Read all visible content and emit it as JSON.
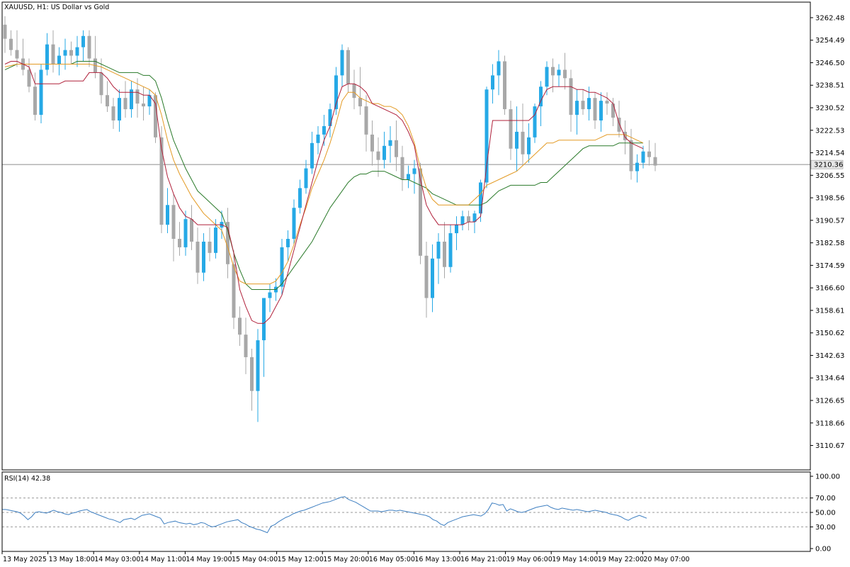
{
  "chart_data": [
    {
      "type": "candlestick",
      "title": "XAUUSD, H1:  US Dollar vs Gold",
      "price_axis": {
        "ylim": [
          3102.0,
          3268.0
        ],
        "ticks": [
          "3262.48",
          "3254.49",
          "3246.50",
          "3238.51",
          "3230.52",
          "3222.53",
          "3214.54",
          "3206.55",
          "3198.56",
          "3190.57",
          "3182.58",
          "3174.59",
          "3166.60",
          "3158.61",
          "3150.62",
          "3142.63",
          "3134.64",
          "3126.65",
          "3118.66",
          "3110.67"
        ]
      },
      "current_price": {
        "value": 3210.36,
        "label": "3210.36"
      },
      "x_labels": [
        "13 May 2025",
        "13 May 18:00",
        "14 May 03:00",
        "14 May 11:00",
        "14 May 19:00",
        "15 May 04:00",
        "15 May 12:00",
        "15 May 20:00",
        "16 May 05:00",
        "16 May 13:00",
        "16 May 21:00",
        "19 May 06:00",
        "19 May 14:00",
        "19 May 22:00",
        "20 May 07:00"
      ],
      "colors": {
        "bull": "#26A9E6",
        "bear": "#A8A8A8",
        "ma_fast": "#B0203A",
        "ma_mid": "#E39A24",
        "ma_slow": "#2A7A2A",
        "price_line": "#8C8C8C"
      },
      "ohlc": [
        [
          3260,
          3263,
          3250,
          3255
        ],
        [
          3255,
          3258,
          3249,
          3251
        ],
        [
          3251,
          3258,
          3245,
          3248
        ],
        [
          3248,
          3255,
          3242,
          3244
        ],
        [
          3244,
          3248,
          3236,
          3238
        ],
        [
          3238,
          3243,
          3226,
          3228
        ],
        [
          3228,
          3246,
          3225,
          3244
        ],
        [
          3244,
          3257,
          3242,
          3253
        ],
        [
          3253,
          3258,
          3243,
          3246
        ],
        [
          3246,
          3252,
          3242,
          3249
        ],
        [
          3249,
          3255,
          3244,
          3251
        ],
        [
          3251,
          3254,
          3246,
          3249
        ],
        [
          3249,
          3256,
          3245,
          3252
        ],
        [
          3252,
          3258,
          3247,
          3256
        ],
        [
          3256,
          3258,
          3245,
          3248
        ],
        [
          3248,
          3256,
          3241,
          3243
        ],
        [
          3243,
          3248,
          3232,
          3235
        ],
        [
          3235,
          3240,
          3229,
          3231
        ],
        [
          3231,
          3234,
          3223,
          3226
        ],
        [
          3226,
          3237,
          3222,
          3234
        ],
        [
          3234,
          3240,
          3227,
          3230
        ],
        [
          3230,
          3240,
          3227,
          3237
        ],
        [
          3237,
          3241,
          3227,
          3232
        ],
        [
          3232,
          3238,
          3226,
          3231
        ],
        [
          3231,
          3237,
          3228,
          3235
        ],
        [
          3235,
          3236,
          3218,
          3220
        ],
        [
          3220,
          3224,
          3186,
          3189
        ],
        [
          3189,
          3202,
          3186,
          3196
        ],
        [
          3196,
          3200,
          3176,
          3184
        ],
        [
          3184,
          3190,
          3178,
          3181
        ],
        [
          3181,
          3194,
          3178,
          3191
        ],
        [
          3191,
          3196,
          3180,
          3183
        ],
        [
          3183,
          3188,
          3168,
          3172
        ],
        [
          3172,
          3186,
          3169,
          3183
        ],
        [
          3183,
          3188,
          3176,
          3179
        ],
        [
          3179,
          3191,
          3177,
          3188
        ],
        [
          3188,
          3194,
          3184,
          3190
        ],
        [
          3190,
          3195,
          3170,
          3175
        ],
        [
          3175,
          3180,
          3152,
          3156
        ],
        [
          3156,
          3160,
          3146,
          3150
        ],
        [
          3150,
          3156,
          3136,
          3142
        ],
        [
          3142,
          3145,
          3123,
          3130
        ],
        [
          3130,
          3152,
          3119,
          3148
        ],
        [
          3148,
          3161,
          3135,
          3163
        ],
        [
          3163,
          3168,
          3158,
          3165
        ],
        [
          3165,
          3170,
          3162,
          3167
        ],
        [
          3167,
          3184,
          3164,
          3181
        ],
        [
          3181,
          3187,
          3176,
          3184
        ],
        [
          3184,
          3198,
          3182,
          3195
        ],
        [
          3195,
          3205,
          3193,
          3202
        ],
        [
          3202,
          3212,
          3200,
          3209
        ],
        [
          3209,
          3222,
          3207,
          3218
        ],
        [
          3218,
          3224,
          3214,
          3221
        ],
        [
          3221,
          3228,
          3217,
          3224
        ],
        [
          3224,
          3232,
          3220,
          3230
        ],
        [
          3230,
          3245,
          3228,
          3242
        ],
        [
          3242,
          3253,
          3238,
          3251
        ],
        [
          3251,
          3252,
          3236,
          3239
        ],
        [
          3239,
          3244,
          3230,
          3234
        ],
        [
          3234,
          3245,
          3228,
          3231
        ],
        [
          3231,
          3235,
          3215,
          3221
        ],
        [
          3221,
          3226,
          3210,
          3215
        ],
        [
          3215,
          3220,
          3206,
          3212
        ],
        [
          3212,
          3222,
          3209,
          3217
        ],
        [
          3217,
          3224,
          3211,
          3219
        ],
        [
          3219,
          3226,
          3208,
          3213
        ],
        [
          3213,
          3217,
          3201,
          3205
        ],
        [
          3205,
          3210,
          3202,
          3207
        ],
        [
          3207,
          3212,
          3200,
          3209
        ],
        [
          3209,
          3211,
          3175,
          3178
        ],
        [
          3178,
          3183,
          3156,
          3163
        ],
        [
          3163,
          3182,
          3158,
          3177
        ],
        [
          3177,
          3186,
          3168,
          3183
        ],
        [
          3183,
          3190,
          3170,
          3174
        ],
        [
          3174,
          3189,
          3172,
          3186
        ],
        [
          3186,
          3192,
          3180,
          3189
        ],
        [
          3189,
          3194,
          3187,
          3192
        ],
        [
          3192,
          3194,
          3187,
          3190
        ],
        [
          3190,
          3194,
          3186,
          3193
        ],
        [
          3193,
          3205,
          3190,
          3204
        ],
        [
          3204,
          3238,
          3202,
          3237
        ],
        [
          3237,
          3246,
          3232,
          3242
        ],
        [
          3242,
          3251,
          3235,
          3247
        ],
        [
          3247,
          3249,
          3228,
          3230
        ],
        [
          3230,
          3233,
          3212,
          3216
        ],
        [
          3216,
          3231,
          3208,
          3222
        ],
        [
          3222,
          3232,
          3210,
          3214
        ],
        [
          3214,
          3225,
          3211,
          3220
        ],
        [
          3220,
          3232,
          3218,
          3231
        ],
        [
          3231,
          3240,
          3224,
          3238
        ],
        [
          3238,
          3247,
          3235,
          3245
        ],
        [
          3245,
          3248,
          3236,
          3242
        ],
        [
          3242,
          3246,
          3238,
          3244
        ],
        [
          3244,
          3250,
          3237,
          3241
        ],
        [
          3241,
          3244,
          3222,
          3228
        ],
        [
          3228,
          3237,
          3221,
          3233
        ],
        [
          3233,
          3237,
          3228,
          3230
        ],
        [
          3230,
          3238,
          3226,
          3234
        ],
        [
          3234,
          3236,
          3223,
          3226
        ],
        [
          3226,
          3236,
          3222,
          3233
        ],
        [
          3233,
          3236,
          3228,
          3232
        ],
        [
          3232,
          3234,
          3224,
          3227
        ],
        [
          3227,
          3233,
          3220,
          3222
        ],
        [
          3222,
          3226,
          3214,
          3219
        ],
        [
          3219,
          3223,
          3205,
          3208
        ],
        [
          3208,
          3214,
          3204,
          3211
        ],
        [
          3211,
          3217,
          3209,
          3215
        ],
        [
          3215,
          3219,
          3210,
          3213
        ],
        [
          3213,
          3218,
          3208,
          3210
        ]
      ],
      "ma_fast": [
        3246,
        3247,
        3247,
        3246,
        3245,
        3239,
        3239,
        3239,
        3239,
        3239,
        3240,
        3240,
        3240,
        3240,
        3243,
        3243,
        3243,
        3241,
        3238,
        3236,
        3236,
        3236,
        3236,
        3235,
        3235,
        3232,
        3216,
        3206,
        3200,
        3195,
        3192,
        3191,
        3189,
        3189,
        3189,
        3189,
        3189,
        3188,
        3179,
        3166,
        3160,
        3155,
        3154,
        3154,
        3156,
        3160,
        3164,
        3172,
        3180,
        3188,
        3196,
        3204,
        3212,
        3219,
        3224,
        3232,
        3238,
        3239,
        3239,
        3238,
        3236,
        3232,
        3231,
        3230,
        3229,
        3228,
        3226,
        3222,
        3217,
        3205,
        3196,
        3192,
        3189,
        3189,
        3189,
        3189,
        3189,
        3190,
        3190,
        3192,
        3210,
        3226,
        3226,
        3226,
        3226,
        3226,
        3226,
        3226,
        3228,
        3233,
        3237,
        3238,
        3238,
        3238,
        3238,
        3237,
        3237,
        3236,
        3236,
        3235,
        3234,
        3232,
        3225,
        3220,
        3218,
        3217,
        3216
      ],
      "ma_mid": [
        3245,
        3245.5,
        3246,
        3246,
        3246,
        3246,
        3246,
        3246,
        3246,
        3246,
        3246,
        3246,
        3246,
        3246,
        3246,
        3245.5,
        3245,
        3244,
        3243,
        3242,
        3241,
        3240,
        3239,
        3238,
        3237,
        3235,
        3228,
        3219,
        3212,
        3207,
        3203,
        3199,
        3196,
        3193,
        3191,
        3189,
        3187,
        3181,
        3174,
        3169,
        3168,
        3168,
        3168,
        3168,
        3168,
        3169,
        3172,
        3176,
        3182,
        3189,
        3195,
        3202,
        3207,
        3212,
        3218,
        3225,
        3233,
        3236,
        3236,
        3234,
        3233,
        3232,
        3232,
        3231,
        3231,
        3230,
        3228,
        3224,
        3218,
        3209,
        3202,
        3198,
        3196,
        3196,
        3196,
        3196,
        3196,
        3196,
        3198,
        3200,
        3203,
        3204,
        3205,
        3206,
        3207,
        3208,
        3210,
        3212,
        3214,
        3216,
        3218,
        3218,
        3219,
        3219,
        3219,
        3219,
        3219,
        3219,
        3219,
        3220,
        3221,
        3221,
        3221,
        3221,
        3220,
        3219,
        3218
      ],
      "ma_slow": [
        3244,
        3245,
        3246,
        3246,
        3246,
        3246,
        3246,
        3246,
        3246,
        3246,
        3246,
        3246,
        3247,
        3247,
        3247,
        3247,
        3246,
        3245,
        3244,
        3243,
        3243,
        3243,
        3243,
        3242,
        3242,
        3240,
        3234,
        3226,
        3219,
        3214,
        3209,
        3205,
        3201,
        3199,
        3197,
        3195,
        3193,
        3187,
        3179,
        3173,
        3168,
        3166,
        3166,
        3166,
        3166,
        3166,
        3168,
        3171,
        3174,
        3177,
        3180,
        3183,
        3187,
        3191,
        3195,
        3198,
        3201,
        3204,
        3206,
        3207,
        3207,
        3208,
        3208,
        3208,
        3207,
        3206,
        3205,
        3205,
        3204,
        3203,
        3202,
        3200,
        3199,
        3198,
        3197,
        3196,
        3196,
        3196,
        3196,
        3196,
        3197,
        3199,
        3201,
        3202,
        3203,
        3203,
        3203,
        3203,
        3203,
        3204,
        3204,
        3206,
        3208,
        3210,
        3212,
        3214,
        3216,
        3217,
        3217,
        3217,
        3217,
        3217,
        3218,
        3218,
        3218,
        3218,
        3218
      ]
    },
    {
      "type": "line",
      "title": "RSI(14) 42.38",
      "ylim": [
        0,
        100
      ],
      "ticks": [
        "100.00",
        "70.00",
        "50.00",
        "30.00",
        "0.00"
      ],
      "levels": [
        70,
        50,
        30
      ],
      "color": "#3E7FC1",
      "values": [
        54,
        54,
        53,
        52,
        51,
        49,
        45,
        40,
        44,
        50,
        51,
        50,
        49,
        51,
        53,
        51,
        50,
        48,
        47,
        49,
        50,
        52,
        53,
        54,
        51,
        49,
        47,
        45,
        43,
        41,
        40,
        38,
        36,
        40,
        41,
        42,
        40,
        43,
        46,
        47,
        48,
        46,
        44,
        42,
        34,
        36,
        37,
        38,
        36,
        35,
        34,
        35,
        33,
        34,
        36,
        35,
        32,
        30,
        31,
        33,
        35,
        37,
        38,
        39,
        40,
        36,
        34,
        31,
        29,
        27,
        26,
        24,
        22,
        31,
        33,
        37,
        40,
        43,
        45,
        48,
        50,
        52,
        53,
        55,
        57,
        59,
        61,
        63,
        64,
        65,
        67,
        69,
        71,
        72,
        68,
        66,
        64,
        61,
        58,
        55,
        52,
        52,
        52,
        51,
        52,
        53,
        53,
        52,
        53,
        52,
        51,
        50,
        49,
        48,
        47,
        46,
        44,
        40,
        38,
        34,
        32,
        36,
        38,
        40,
        42,
        44,
        45,
        46,
        47,
        46,
        45,
        48,
        54,
        63,
        62,
        60,
        61,
        52,
        55,
        53,
        51,
        50,
        51,
        53,
        55,
        57,
        58,
        59,
        60,
        57,
        55,
        54,
        56,
        55,
        54,
        53,
        54,
        53,
        52,
        51,
        52,
        53,
        52,
        51,
        50,
        48,
        47,
        46,
        44,
        41,
        39,
        42,
        44,
        46,
        44,
        42
      ]
    }
  ]
}
